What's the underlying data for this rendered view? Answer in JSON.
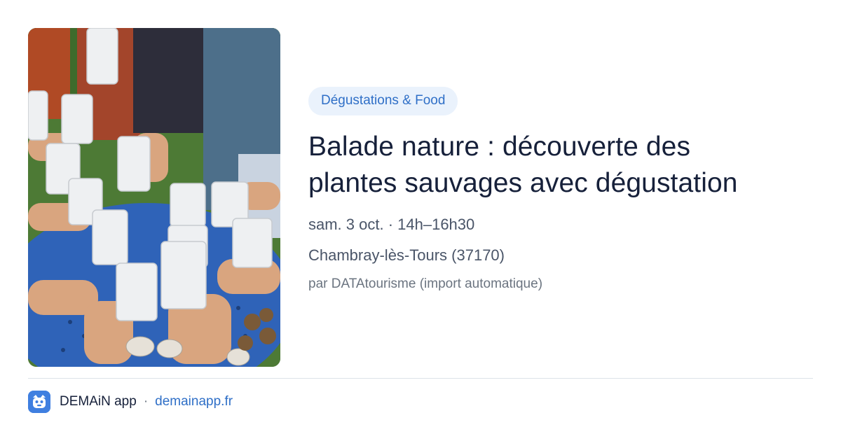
{
  "event": {
    "category": "Dégustations & Food",
    "title_line1": "Balade nature : découverte des",
    "title_line2": "plantes sauvages avec dégustation",
    "datetime": "sam. 3 oct. · 14h–16h30",
    "location": "Chambray-lès-Tours (37170)",
    "source": "par DATAtourisme (import automatique)"
  },
  "footer": {
    "app_name": "DEMAiN app",
    "separator": "·",
    "domain": "demainapp.fr"
  },
  "colors": {
    "accent": "#2f6fc7",
    "pill_background": "#eaf2fc",
    "title": "#16203a",
    "logo": "#3f7fe0"
  },
  "icons": {
    "app_logo": "demain-app-logo-icon"
  }
}
